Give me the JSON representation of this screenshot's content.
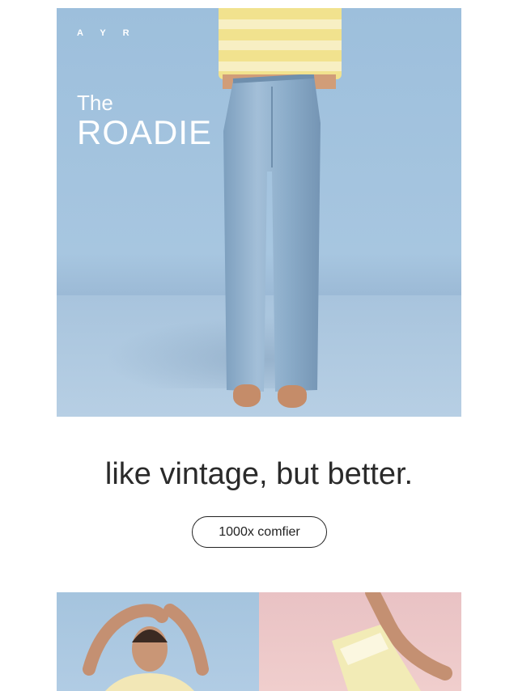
{
  "hero": {
    "brand": "A Y R",
    "title_small": "The",
    "title_large": "ROADIE"
  },
  "tagline": "like vintage, but better.",
  "cta_label": "1000x comfier",
  "colors": {
    "hero_bg": "#a7c6e0",
    "denim": "#8fb0cc",
    "tee_yellow": "#f1e28e",
    "tile_pink": "#f0cecd"
  }
}
